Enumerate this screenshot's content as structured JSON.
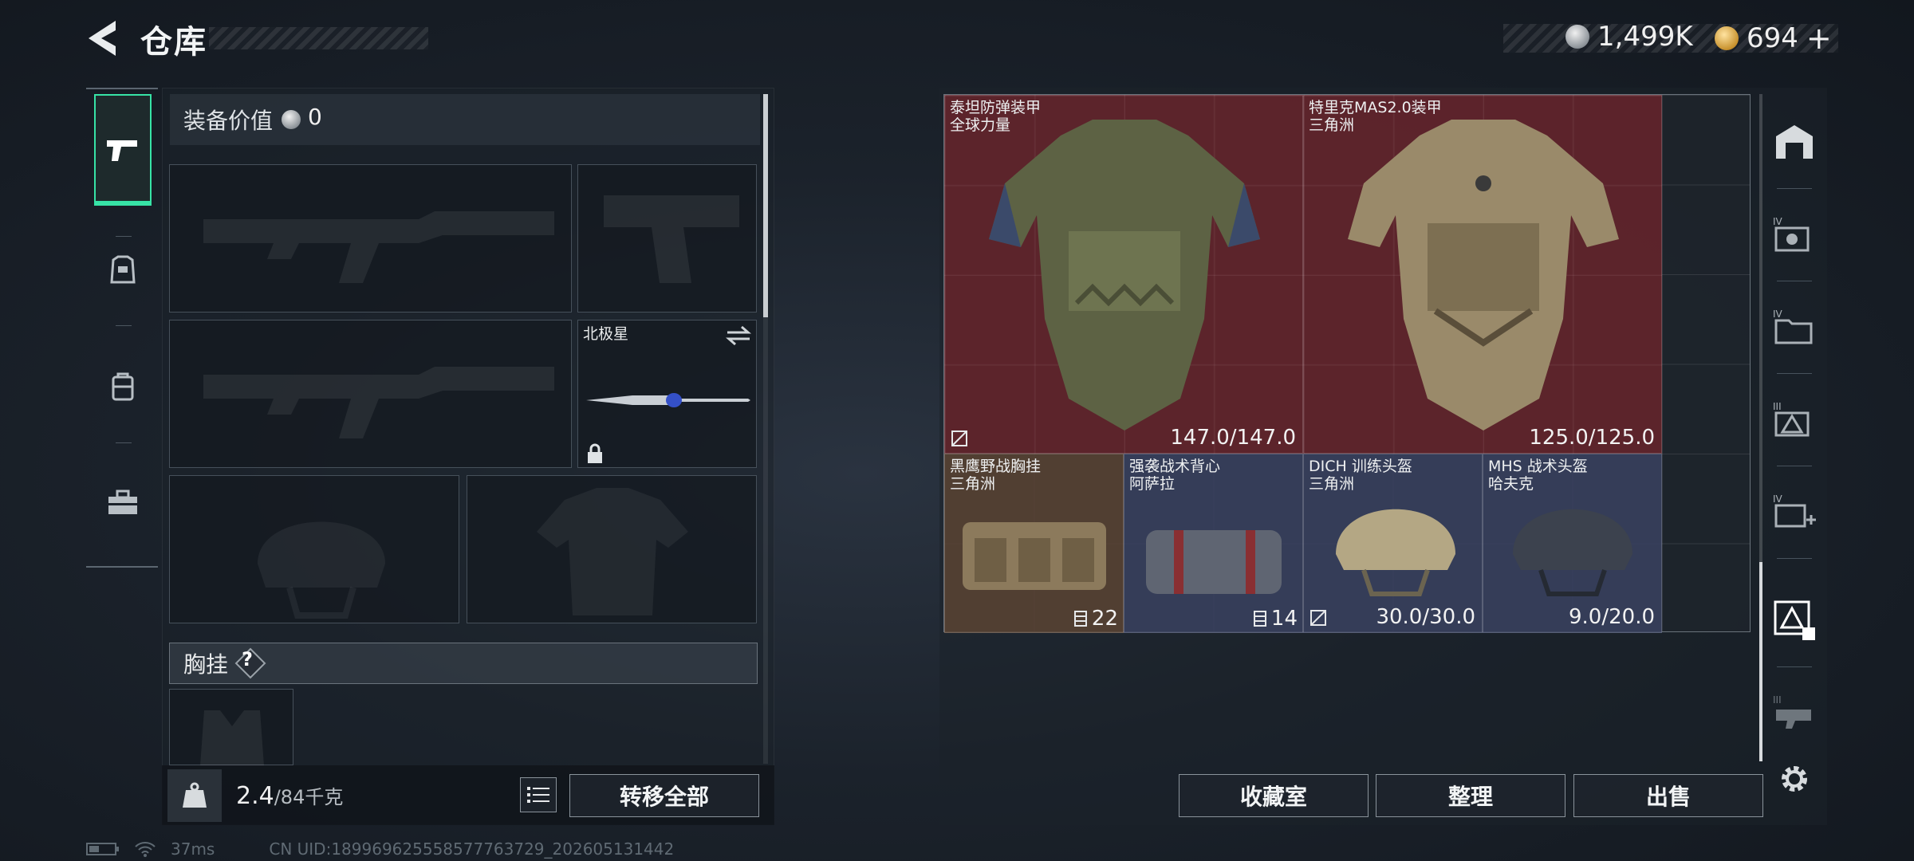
{
  "header": {
    "title": "仓库",
    "currency": {
      "silver_value": "1,499K",
      "gold_value": "694",
      "gold_add": "+"
    }
  },
  "loadout": {
    "value_label": "装备价值",
    "value_amount": "0",
    "knife_label": "北极星",
    "section_label": "胸挂",
    "section_help": "?",
    "weight_current": "2.4",
    "weight_max": "/84千克",
    "transfer_all_label": "转移全部"
  },
  "storage": {
    "items": [
      {
        "name": "泰坦防弹装甲\n全球力量",
        "durability": "147.0/147.0"
      },
      {
        "name": "特里克MAS2.0装甲\n三角洲",
        "durability": "125.0/125.0"
      },
      {
        "name": "黑鹰野战胸挂\n三角洲",
        "capacity": "22"
      },
      {
        "name": "强袭战术背心\n阿萨拉",
        "capacity": "14"
      },
      {
        "name": "DICH 训练头盔\n三角洲",
        "durability": "30.0/30.0"
      },
      {
        "name": "MHS 战术头盔\n哈夫克",
        "durability": "9.0/20.0"
      }
    ],
    "buttons": {
      "collection": "收藏室",
      "organize": "整理",
      "sell": "出售"
    }
  },
  "filters": {
    "tiers": [
      "IV",
      "IV",
      "III",
      "IV",
      "III"
    ]
  },
  "status": {
    "ping": "37ms",
    "uid": "CN UID:189969625558577763729_202605131442"
  },
  "colors": {
    "accent": "#37e3a6",
    "red_rarity": "#6e242c",
    "blue_rarity": "#3a4260",
    "brown_rarity": "#5a4434"
  }
}
